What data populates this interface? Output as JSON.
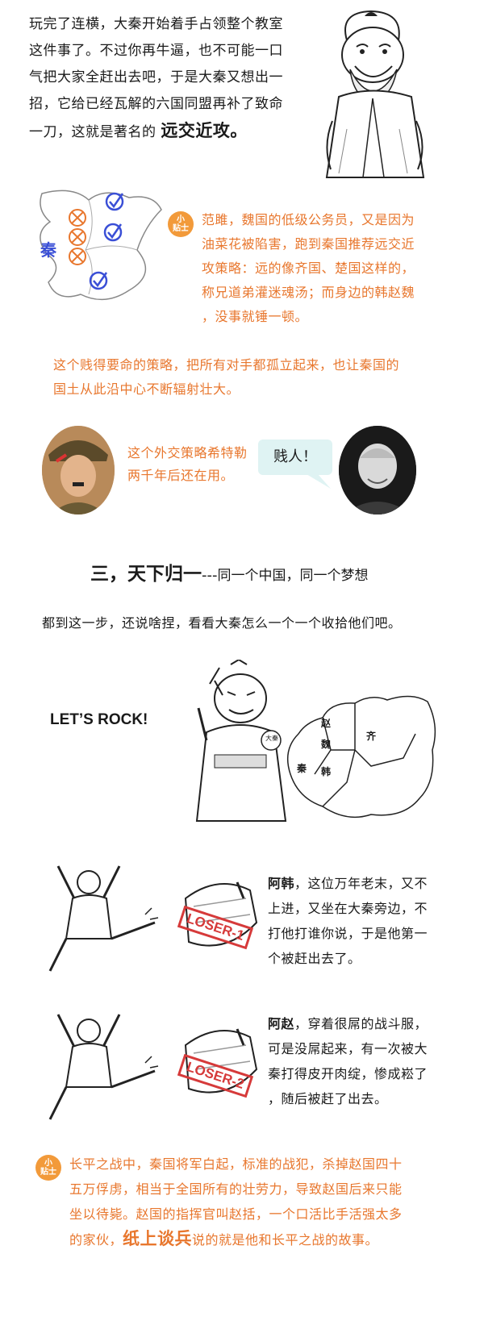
{
  "intro": {
    "lines": [
      "玩完了连横，大秦开始着手占领整个教室",
      "这件事了。不过你再牛逼，也不可能一口",
      "气把大家全赶出去吧，于是大秦又想出一",
      "招，它给已经瓦解的六国同盟再补了致命"
    ],
    "last_line": "一刀，这就是著名的",
    "highlight": "远交近攻。"
  },
  "map1": {
    "label": "秦"
  },
  "tip_badge": {
    "line1": "小",
    "line2": "贴士"
  },
  "tip1": {
    "lines": [
      "范雎，魏国的低级公务员，又是因为",
      "油菜花被陷害，跑到秦国推荐远交近",
      "攻策略：远的像齐国、楚国这样的，",
      "称兄道弟灌迷魂汤；而身边的韩赵魏",
      "，没事就锤一顿。"
    ]
  },
  "strategy": {
    "lines": [
      "这个贱得要命的策略，把所有对手都孤立起来，也让秦国的",
      "国土从此沿中心不断辐射壮大。"
    ]
  },
  "hitler": {
    "lines": [
      "这个外交策略希特勒",
      "两千年后还在用。"
    ]
  },
  "bubble": {
    "text": "贱人！"
  },
  "section3": {
    "title": "三，天下归一",
    "dashes": "---",
    "subtitle": "同一个中国，同一个梦想"
  },
  "lead": {
    "text": "都到这一步，还说啥捏，看看大秦怎么一个一个收拾他们吧。"
  },
  "rock": {
    "text": "LET’S ROCK!"
  },
  "map2": {
    "zhao": "赵",
    "qi": "齐",
    "wei": "魏",
    "qin": "秦",
    "han": "韩",
    "badge": "大秦"
  },
  "loser1": {
    "stamp": "LOSER-1",
    "name": "阿韩",
    "first": "，这位万年老末，又不",
    "lines": [
      "上进，又坐在大秦旁边，不",
      "打他打谁你说，于是他第一",
      "个被赶出去了。"
    ]
  },
  "loser2": {
    "stamp": "LOSER-2",
    "name": "阿赵",
    "first": "，穿着很屌的战斗服，",
    "lines": [
      "可是没屌起来，有一次被大",
      "秦打得皮开肉绽，惨成崧了",
      "，随后被赶了出去。"
    ]
  },
  "tip2": {
    "lines": [
      "长平之战中，秦国将军白起，标准的战犯，杀掉赵国四十",
      "五万俘虏，相当于全国所有的壮劳力，导致赵国后来只能",
      "坐以待毙。赵国的指挥官叫赵括，一个口活比手活强太多"
    ],
    "last_pre": "的家伙，",
    "idiom": "纸上谈兵",
    "last_post": "说的就是他和长平之战的故事。"
  },
  "colors": {
    "accent": "#e8772e",
    "check": "#3a4fd6",
    "cross": "#e8772e",
    "stamp": "#d63a3a",
    "bubble": "#dff3f3"
  },
  "icons": [
    "confucius-cartoon",
    "checkmark-icon",
    "cross-icon",
    "tip-badge-icon",
    "hitler-portrait",
    "eisenhower-portrait",
    "qin-emperor-cartoon",
    "kicking-warrior-cartoon",
    "knocked-out-figure-cartoon"
  ]
}
